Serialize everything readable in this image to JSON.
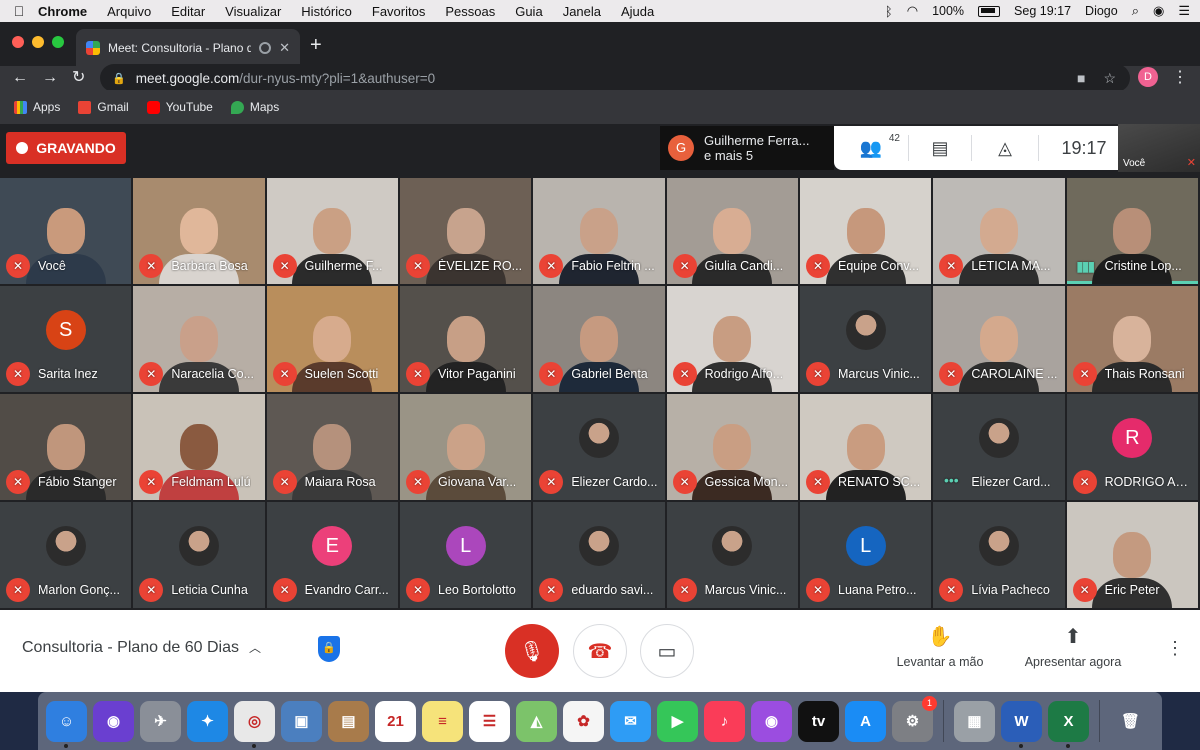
{
  "menubar": {
    "app": "Chrome",
    "items": [
      "Arquivo",
      "Editar",
      "Visualizar",
      "Histórico",
      "Favoritos",
      "Pessoas",
      "Guia",
      "Janela",
      "Ajuda"
    ],
    "battery": "100%",
    "datetime": "Seg 19:17",
    "user": "Diogo"
  },
  "browser": {
    "tab_title": "Meet: Consultoria - Plano d",
    "url_host": "meet.google.com",
    "url_path": "/dur-nyus-mty?pli=1&authuser=0",
    "profile_initial": "D",
    "bookmarks": [
      {
        "label": "Apps",
        "color": "#8ab4f8"
      },
      {
        "label": "Gmail",
        "color": "#ea4335"
      },
      {
        "label": "YouTube",
        "color": "#ff0000"
      },
      {
        "label": "Maps",
        "color": "#34a853"
      }
    ]
  },
  "meet": {
    "recording_label": "GRAVANDO",
    "presenter_name": "Guilherme Ferra...",
    "presenter_more": "e mais 5",
    "presenter_initial": "G",
    "participant_count": "42",
    "clock": "19:17",
    "self_label": "Você",
    "meeting_name": "Consultoria - Plano de 60 Dias",
    "raise_hand_label": "Levantar a mão",
    "present_label": "Apresentar agora"
  },
  "tiles": [
    {
      "name": "Você",
      "type": "video",
      "bg": "#3f4a55",
      "skin": "#c99a7c",
      "shirt": "#2d3a4a",
      "mic": "muted"
    },
    {
      "name": "Barbara Bosa",
      "type": "video",
      "bg": "#a88b6e",
      "skin": "#e0b79a",
      "shirt": "#d9d4cf",
      "mic": "muted"
    },
    {
      "name": "Guilherme F...",
      "type": "video",
      "bg": "#cfcac4",
      "skin": "#caa084",
      "shirt": "#2b2b2b",
      "mic": "muted"
    },
    {
      "name": "ÈVELIZE RO...",
      "type": "video",
      "bg": "#6d6055",
      "skin": "#c7a38d",
      "shirt": "#3b3430",
      "mic": "muted"
    },
    {
      "name": "Fabio Feltrin ...",
      "type": "video",
      "bg": "#b9b4ae",
      "skin": "#c9a189",
      "shirt": "#1f2530",
      "mic": "muted"
    },
    {
      "name": "Giulia Candi...",
      "type": "video",
      "bg": "#a39c95",
      "skin": "#d8ad93",
      "shirt": "#2a2a2a",
      "mic": "muted"
    },
    {
      "name": "Equipe Conv...",
      "type": "video",
      "bg": "#d6d2cc",
      "skin": "#c6987c",
      "shirt": "#303030",
      "mic": "muted"
    },
    {
      "name": "LETICIA MA...",
      "type": "video",
      "bg": "#bdbab6",
      "skin": "#d3aa90",
      "shirt": "#2e2e2e",
      "mic": "muted"
    },
    {
      "name": "Cristine Lop...",
      "type": "video",
      "bg": "#6f6a5c",
      "skin": "#b88f78",
      "shirt": "#1d1d1d",
      "mic": "speaking",
      "active": true
    },
    {
      "name": "Sarita Inez",
      "type": "letter",
      "letter": "S",
      "color": "#d84315",
      "mic": "muted"
    },
    {
      "name": "Naracelia Co...",
      "type": "video",
      "bg": "#b7aea5",
      "skin": "#c9a08a",
      "shirt": "#3a3a3a",
      "mic": "muted"
    },
    {
      "name": "Suelen Scotti",
      "type": "video",
      "bg": "#b98e5c",
      "skin": "#d7ab8d",
      "shirt": "#5a3b2c",
      "mic": "muted"
    },
    {
      "name": "Vitor Paganini",
      "type": "video",
      "bg": "#54504b",
      "skin": "#c79f86",
      "shirt": "#232323",
      "mic": "muted"
    },
    {
      "name": "Gabriel Benta",
      "type": "video",
      "bg": "#8c8680",
      "skin": "#c69a80",
      "shirt": "#1e2a3a",
      "mic": "muted"
    },
    {
      "name": "Rodrigo Alfo...",
      "type": "video",
      "bg": "#d8d4d0",
      "skin": "#c89d82",
      "shirt": "#303030",
      "mic": "muted"
    },
    {
      "name": "Marcus Vinic...",
      "type": "photo",
      "mic": "muted"
    },
    {
      "name": "CAROLAINE ...",
      "type": "video",
      "bg": "#a9a39e",
      "skin": "#d4a98d",
      "shirt": "#2d2d2d",
      "mic": "muted"
    },
    {
      "name": "Thais Ronsani",
      "type": "video",
      "bg": "#9b7b64",
      "skin": "#d8b39b",
      "shirt": "#2b2b2b",
      "mic": "muted"
    },
    {
      "name": "Fábio Stanger",
      "type": "video",
      "bg": "#514c47",
      "skin": "#c0967c",
      "shirt": "#2a2a2a",
      "mic": "muted"
    },
    {
      "name": "Feldmam Lulú",
      "type": "video",
      "bg": "#c9c2b8",
      "skin": "#8a5a40",
      "shirt": "#c04040",
      "mic": "muted"
    },
    {
      "name": "Maiara Rosa",
      "type": "video",
      "bg": "#5e5853",
      "skin": "#b5917c",
      "shirt": "#3a3a3a",
      "mic": "muted"
    },
    {
      "name": "Giovana Var...",
      "type": "video",
      "bg": "#9a9486",
      "skin": "#cba288",
      "shirt": "#5b4b3b",
      "mic": "muted"
    },
    {
      "name": "Eliezer Cardo...",
      "type": "photo",
      "mic": "muted"
    },
    {
      "name": "Gessica Mon...",
      "type": "video",
      "bg": "#b7b0a7",
      "skin": "#c99e83",
      "shirt": "#3b2a22",
      "mic": "muted"
    },
    {
      "name": "RENATO SC...",
      "type": "video",
      "bg": "#cfc9c1",
      "skin": "#c99c80",
      "shirt": "#222",
      "mic": "muted"
    },
    {
      "name": "Eliezer Card...",
      "type": "photo",
      "mic": "dots"
    },
    {
      "name": "RODRIGO AN...",
      "type": "letter",
      "letter": "R",
      "color": "#e52b6b",
      "mic": "muted"
    },
    {
      "name": "Marlon Gonç...",
      "type": "photo",
      "mic": "muted"
    },
    {
      "name": "Leticia Cunha",
      "type": "photo",
      "mic": "muted"
    },
    {
      "name": "Evandro Carr...",
      "type": "letter",
      "letter": "E",
      "color": "#ec407a",
      "mic": "muted"
    },
    {
      "name": "Leo Bortolotto",
      "type": "letter",
      "letter": "L",
      "color": "#ab47bc",
      "mic": "muted"
    },
    {
      "name": "eduardo savi...",
      "type": "photo",
      "mic": "muted"
    },
    {
      "name": "Marcus Vinic...",
      "type": "photo",
      "mic": "muted"
    },
    {
      "name": "Luana Petro...",
      "type": "letter",
      "letter": "L",
      "color": "#1565c0",
      "mic": "muted"
    },
    {
      "name": "Lívia Pacheco",
      "type": "photo",
      "mic": "muted"
    },
    {
      "name": "Eric Peter",
      "type": "video",
      "bg": "#cbc6bf",
      "skin": "#c49a80",
      "shirt": "#303030",
      "mic": "muted"
    }
  ],
  "dock": [
    {
      "name": "finder-icon",
      "bg": "#2f7fe0",
      "glyph": "☺",
      "run": true
    },
    {
      "name": "siri-icon",
      "bg": "#6a3fd0",
      "glyph": "◉"
    },
    {
      "name": "launchpad-icon",
      "bg": "#8a8f98",
      "glyph": "✈"
    },
    {
      "name": "safari-icon",
      "bg": "#1e88e5",
      "glyph": "✦"
    },
    {
      "name": "chrome-icon",
      "bg": "#e8e8e8",
      "glyph": "◎",
      "run": true
    },
    {
      "name": "preview-icon",
      "bg": "#4b7fbf",
      "glyph": "▣"
    },
    {
      "name": "notes-brown-icon",
      "bg": "#a87b4b",
      "glyph": "▤"
    },
    {
      "name": "calendar-icon",
      "bg": "#ffffff",
      "glyph": "21"
    },
    {
      "name": "notes-icon",
      "bg": "#f6e37a",
      "glyph": "≡"
    },
    {
      "name": "reminders-icon",
      "bg": "#ffffff",
      "glyph": "☰"
    },
    {
      "name": "maps-icon",
      "bg": "#7cc36a",
      "glyph": "◭"
    },
    {
      "name": "photos-icon",
      "bg": "#f5f5f5",
      "glyph": "✿"
    },
    {
      "name": "messages-icon",
      "bg": "#2e9cf5",
      "glyph": "✉"
    },
    {
      "name": "facetime-icon",
      "bg": "#35c659",
      "glyph": "▶"
    },
    {
      "name": "music-icon",
      "bg": "#fa3c58",
      "glyph": "♪"
    },
    {
      "name": "podcasts-icon",
      "bg": "#9b4de0",
      "glyph": "◉"
    },
    {
      "name": "tv-icon",
      "bg": "#111111",
      "glyph": "tv"
    },
    {
      "name": "appstore-icon",
      "bg": "#1a8cf5",
      "glyph": "A"
    },
    {
      "name": "system-preferences-icon",
      "bg": "#7d7f84",
      "glyph": "⚙",
      "badge": "1"
    },
    {
      "name": "numbers-icon",
      "bg": "#9aa0a6",
      "glyph": "▦"
    },
    {
      "name": "word-icon",
      "bg": "#2b5eb8",
      "glyph": "W",
      "run": true
    },
    {
      "name": "excel-icon",
      "bg": "#1d7a45",
      "glyph": "X",
      "run": true
    },
    {
      "name": "trash-icon",
      "bg": "transparent",
      "glyph": "🗑"
    }
  ]
}
